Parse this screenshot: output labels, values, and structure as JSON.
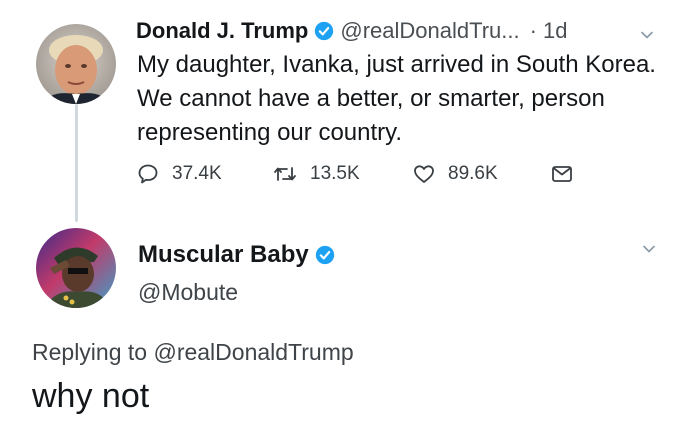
{
  "tweet1": {
    "display_name": "Donald J. Trump",
    "handle": "@realDonaldTru...",
    "dot": "·",
    "timestamp": "1d",
    "text": "My daughter, Ivanka, just arrived in South Korea. We cannot have a better, or smarter, person representing our country.",
    "actions": {
      "replies": "37.4K",
      "retweets": "13.5K",
      "likes": "89.6K"
    }
  },
  "tweet2": {
    "display_name": "Muscular Baby",
    "handle": "@Mobute",
    "replying_prefix": "Replying to",
    "replying_to": "@realDonaldTrump",
    "text": "why not"
  },
  "colors": {
    "verified": "#1da1f2",
    "text": "#14171a",
    "muted": "#4a4f54"
  }
}
